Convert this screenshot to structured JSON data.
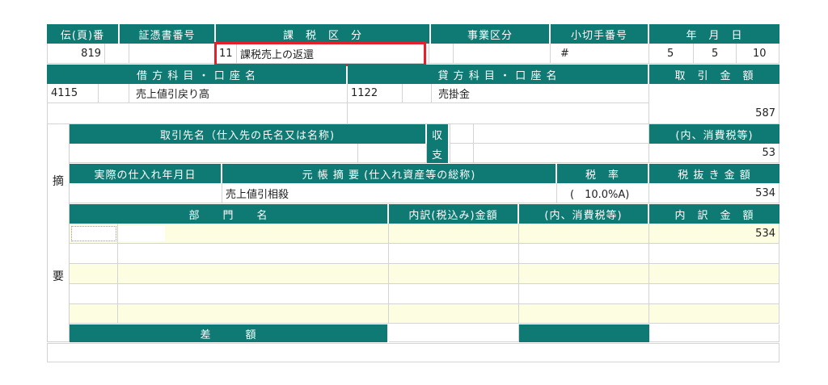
{
  "row1": {
    "headers": {
      "den_no": "伝(頁)番",
      "voucher_no": "証憑書番号",
      "tax_category": "課　税　区　分",
      "business_category": "事業区分",
      "check_no": "小切手番号",
      "date": "年　月　日"
    },
    "values": {
      "den_no": "819",
      "tax_code": "11",
      "tax_name": "課税売上の返還",
      "check_no": "#",
      "year": "5",
      "month": "5",
      "day": "10"
    }
  },
  "row2": {
    "headers": {
      "debit": "借 方 科 目 ・ 口 座 名",
      "credit": "貸 方 科 目 ・ 口 座 名",
      "amount": "取　引　金　額"
    },
    "values": {
      "debit_code": "4115",
      "debit_name": "売上値引戻り高",
      "credit_code": "1122",
      "credit_name": "売掛金",
      "amount": "587"
    }
  },
  "summary": {
    "label_top": "摘",
    "label_bottom": "要",
    "partner_header": "取引先名（仕入先の氏名又は名称)",
    "receive_label": "収",
    "pay_label": "支",
    "tax_inner_header": "(内、消費税等)",
    "tax_inner_value": "53",
    "purchase_date_header": "実際の仕入れ年月日",
    "ledger_header": "元 帳 摘 要 (仕入れ資産等の総称)",
    "ledger_value": "売上値引相殺",
    "tax_rate_header": "税　率",
    "tax_rate_value": "(　10.0%A)",
    "excl_header": "税 抜 き 金 額",
    "excl_value": "534",
    "dept_header": "部　　門　　名",
    "breakdown_incl_header": "内訳(税込み)金額",
    "breakdown_tax_header": "(内、消費税等)",
    "breakdown_amount_header": "内　訳　金　額",
    "breakdown_first_value": "534",
    "diff_label": "差　　　額"
  },
  "colors": {
    "header": "#0f7a73",
    "highlight": "#e3202c",
    "yellow_row": "#fdfde2"
  }
}
